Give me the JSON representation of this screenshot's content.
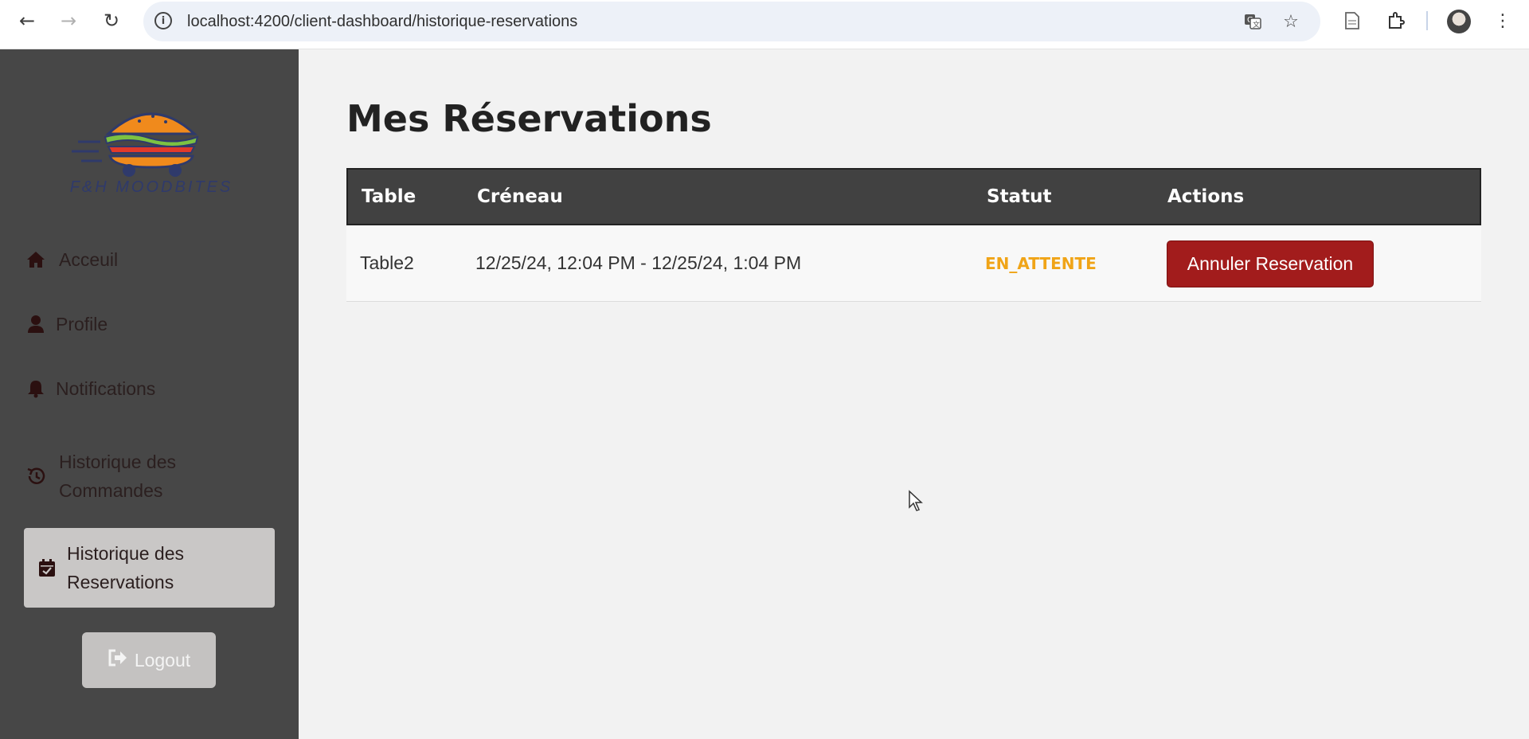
{
  "browser": {
    "url": "localhost:4200/client-dashboard/historique-reservations",
    "icons": [
      "back-icon",
      "forward-icon",
      "reload-icon",
      "site-info-icon",
      "translate-icon",
      "bookmark-star-icon",
      "reading-mode-icon",
      "extensions-icon",
      "profile-avatar",
      "menu-icon"
    ]
  },
  "sidebar": {
    "brand": "F&H MOODBITES",
    "items": [
      {
        "label": "Acceuil",
        "icon": "home-icon"
      },
      {
        "label": "Profile",
        "icon": "user-icon"
      },
      {
        "label": "Notifications",
        "icon": "bell-icon"
      },
      {
        "label": "Historique des Commandes",
        "icon": "history-icon"
      },
      {
        "label": "Historique des Reservations",
        "icon": "calendar-check-icon",
        "active": true
      }
    ],
    "logout_label": "Logout"
  },
  "main": {
    "title": "Mes Réservations",
    "table": {
      "headers": [
        "Table",
        "Créneau",
        "Statut",
        "Actions"
      ],
      "rows": [
        {
          "table": "Table2",
          "creneau": "12/25/24, 12:04 PM - 12/25/24, 1:04 PM",
          "statut": "EN_ATTENTE",
          "action": "Annuler Reservation"
        }
      ]
    }
  },
  "colors": {
    "sidebar_bg": "#474747",
    "active_item_bg": "#c9c7c6",
    "header_bg": "#414141",
    "status_pending": "#f0a417",
    "cancel_button": "#a21c1c"
  }
}
